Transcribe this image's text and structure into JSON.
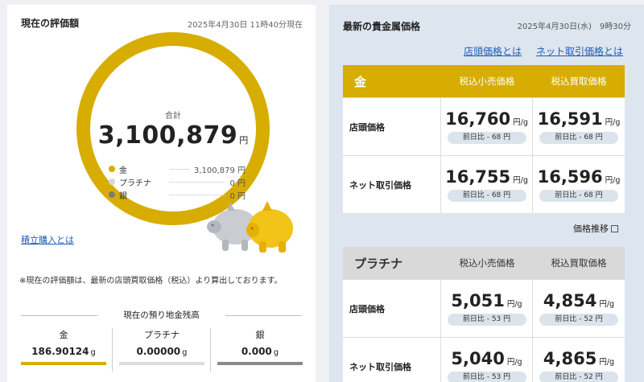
{
  "left": {
    "title": "現在の評価額",
    "date": "2025年4月30日 11時40分現在",
    "total_label": "合計",
    "total_value": "3,100,879",
    "total_unit": "円",
    "legend": [
      {
        "name": "金",
        "value": "3,100,879 円",
        "color": "#d6ad00"
      },
      {
        "name": "プラチナ",
        "value": "0 円",
        "color": "#d8d8d8"
      },
      {
        "name": "銀",
        "value": "0 円",
        "color": "#7a7a7a"
      }
    ],
    "link_tsumitate": "積立購入とは",
    "note": "※現在の評価額は、最新の店頭買取価格（税込）より算出しております。",
    "balance_title": "現在の預り地金残高",
    "balances": [
      {
        "name": "金",
        "value": "186.90124",
        "unit": "g",
        "color": "#d6ad00"
      },
      {
        "name": "プラチナ",
        "value": "0.00000",
        "unit": "g",
        "color": "#dddddd"
      },
      {
        "name": "銀",
        "value": "0.000",
        "unit": "g",
        "color": "#8a8a8a"
      }
    ]
  },
  "right": {
    "title": "最新の貴金属価格",
    "date": "2025年4月30日(水)　9時30分",
    "link_store": "店頭価格とは",
    "link_net": "ネット取引価格とは",
    "trend_label": "価格推移",
    "col_sell": "税込小売価格",
    "col_buy": "税込買取価格",
    "unit": "円/g",
    "gold": {
      "name": "金",
      "color": "#d6ad00",
      "rows": [
        {
          "label": "店頭価格",
          "sell": "16,760",
          "sell_diff": "前日比 - 68 円",
          "buy": "16,591",
          "buy_diff": "前日比 - 68 円"
        },
        {
          "label": "ネット取引価格",
          "sell": "16,755",
          "sell_diff": "前日比 - 68 円",
          "buy": "16,596",
          "buy_diff": "前日比 - 68 円"
        }
      ]
    },
    "platinum": {
      "name": "プラチナ",
      "color": "#d9d9d9",
      "rows": [
        {
          "label": "店頭価格",
          "sell": "5,051",
          "sell_diff": "前日比 - 53 円",
          "buy": "4,854",
          "buy_diff": "前日比 - 52 円"
        },
        {
          "label": "ネット取引価格",
          "sell": "5,040",
          "sell_diff": "前日比 - 53 円",
          "buy": "4,865",
          "buy_diff": "前日比 - 52 円"
        }
      ]
    }
  }
}
